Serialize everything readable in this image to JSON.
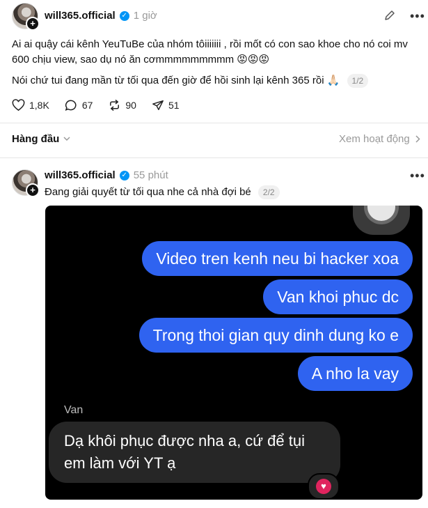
{
  "post1": {
    "username": "will365.official",
    "time": "1 giờ",
    "text_line1": "Ai ai quậy cái kênh YeuTuBe của nhóm tôiiiiiii , rồi mốt có con sao khoe cho nó coi mv 600 chịu view, sao dụ nó ăn cơmmmmmmmmm 😡😡😡",
    "text_line2": "Nói chứ tui đang mần từ tối qua đến giờ để hồi sinh lại kênh 365 rồi 🙏🏻",
    "pager": "1/2",
    "likes": "1,8K",
    "comments": "67",
    "reposts": "90",
    "shares": "51"
  },
  "sort_bar": {
    "label": "Hàng đầu",
    "activity_link": "Xem hoạt động"
  },
  "post2": {
    "username": "will365.official",
    "time": "55 phút",
    "text": "Đang giải quyết từ tối qua nhe cả nhà đợi bé",
    "pager": "2/2",
    "chat": {
      "sent": [
        "Video tren kenh neu bi hacker xoa",
        "Van khoi phuc dc",
        "Trong thoi gian quy dinh dung ko e",
        "A nho la vay"
      ],
      "sender_name": "Van",
      "reply": "Dạ khôi phục được nha a, cứ để tụi em làm với YT ạ"
    }
  },
  "icons": {
    "edit": "pencil-icon",
    "more": "more-icon",
    "like": "heart-icon",
    "comment": "comment-icon",
    "repost": "repost-icon",
    "share": "share-icon"
  },
  "colors": {
    "sent_bubble": "#2f63f0",
    "received_bubble": "#262626",
    "verified": "#0095f6",
    "reaction": "#e0245e"
  }
}
